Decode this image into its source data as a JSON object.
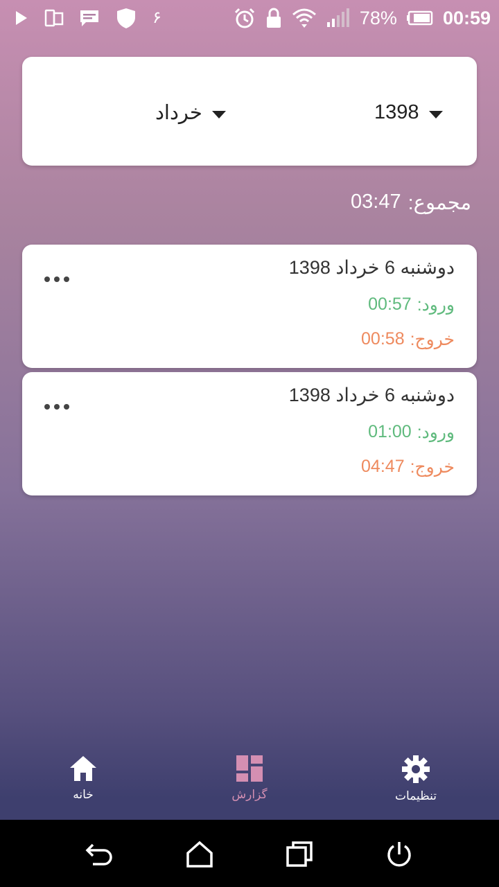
{
  "status_bar": {
    "arabic_digit": "۶",
    "battery_percent": "78%",
    "time": "00:59"
  },
  "filters": {
    "year": "1398",
    "month": "خرداد"
  },
  "total": {
    "label": "مجموع:",
    "value": "03:47"
  },
  "entries": [
    {
      "date": "دوشنبه 6 خرداد 1398",
      "entry_label": "ورود:",
      "entry_time": "00:57",
      "exit_label": "خروج:",
      "exit_time": "00:58"
    },
    {
      "date": "دوشنبه 6 خرداد 1398",
      "entry_label": "ورود:",
      "entry_time": "01:00",
      "exit_label": "خروج:",
      "exit_time": "04:47"
    }
  ],
  "bottom_nav": {
    "home": "خانه",
    "report": "گزارش",
    "settings": "تنظیمات",
    "active": "report"
  },
  "colors": {
    "entry_green": "#5fba7d",
    "exit_orange": "#ee8a5e",
    "active_tab": "#d48fb2"
  }
}
